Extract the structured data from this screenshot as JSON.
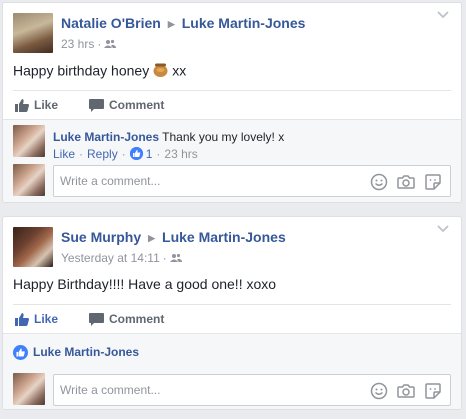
{
  "posts": [
    {
      "author": "Natalie O'Brien",
      "target": "Luke Martin-Jones",
      "time": "23 hrs",
      "text_before": "Happy birthday honey",
      "text_after": "xx",
      "actions": {
        "like": "Like",
        "comment": "Comment"
      },
      "comment": {
        "author": "Luke Martin-Jones",
        "text": "Thank you my lovely! x",
        "like": "Like",
        "reply": "Reply",
        "reactions": "1",
        "time": "23 hrs"
      },
      "write_placeholder": "Write a comment..."
    },
    {
      "author": "Sue Murphy",
      "target": "Luke Martin-Jones",
      "time": "Yesterday at 14:11",
      "text": "Happy Birthday!!!! Have a good one!! xoxo",
      "actions": {
        "like": "Like",
        "comment": "Comment"
      },
      "liked_by": "Luke Martin-Jones",
      "write_placeholder": "Write a comment..."
    }
  ],
  "colors": {
    "link": "#365899",
    "like_blue": "#4267b2",
    "muted": "#90949c",
    "background": "#e9ebee"
  },
  "icons": [
    "chevron-down-icon",
    "friends-icon",
    "honey-pot-emoji-icon",
    "thumbs-up-icon",
    "comment-bubble-icon",
    "like-reaction-icon",
    "emoji-icon",
    "camera-icon",
    "sticker-icon"
  ]
}
